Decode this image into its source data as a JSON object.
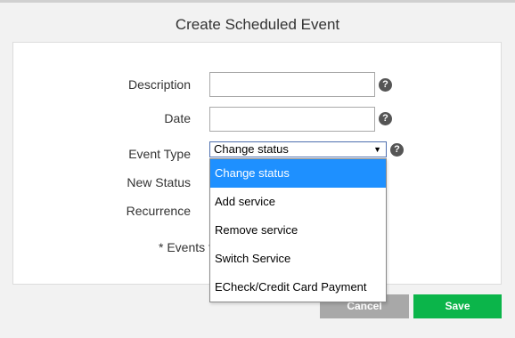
{
  "dialog": {
    "title": "Create Scheduled Event",
    "fields": {
      "description_label": "Description",
      "date_label": "Date",
      "event_type_label": "Event Type",
      "new_status_label": "New Status",
      "recurrence_label": "Recurrence",
      "description_value": "",
      "date_value": ""
    },
    "help_glyph": "?",
    "event_type": {
      "selected": "Change status",
      "options": [
        "Change status",
        "Add service",
        "Remove service",
        "Switch Service",
        "ECheck/Credit Card Payment"
      ]
    },
    "note": "* Events t",
    "buttons": {
      "cancel": "Cancel",
      "save": "Save"
    }
  },
  "colors": {
    "accent": "#1e90ff",
    "save": "#0bb54a",
    "cancel": "#a8a8a8"
  }
}
